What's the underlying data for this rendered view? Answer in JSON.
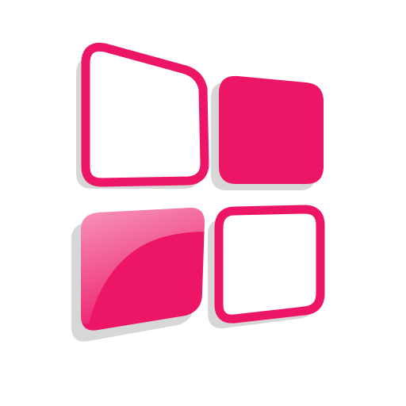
{
  "logo": {
    "icon": "four-tile-window-logo-icon",
    "colors": {
      "accent": "#EC1566",
      "shadow": "#D7D7D7",
      "background": "#FFFFFF",
      "highlight": "#FFFFFF"
    },
    "tiles": [
      {
        "position": "top-left",
        "style": "outline"
      },
      {
        "position": "top-right",
        "style": "filled"
      },
      {
        "position": "bottom-left",
        "style": "filled-glossy"
      },
      {
        "position": "bottom-right",
        "style": "outline"
      }
    ]
  }
}
